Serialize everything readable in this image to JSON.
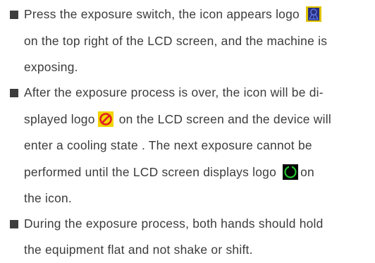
{
  "paragraphs": [
    {
      "lines": [
        {
          "segments": [
            {
              "text": "Press the exposure switch, the icon appears  logo "
            }
          ]
        },
        {
          "segments": [
            {
              "text": "on the top right of the LCD screen, and the machine is"
            }
          ]
        },
        {
          "segments": [
            {
              "text": "exposing."
            }
          ]
        }
      ]
    },
    {
      "lines": [
        {
          "segments": [
            {
              "text": "After the exposure process is over, the icon will be di-"
            }
          ]
        },
        {
          "segments": [
            {
              "text": "splayed logo"
            },
            {
              "text": "  on the LCD screen and the device will"
            }
          ]
        },
        {
          "segments": [
            {
              "text": " enter a cooling state . The  next  exposure  cannot be"
            }
          ]
        },
        {
          "segments": [
            {
              "text": "performed  until  the  LCD screen displays logo "
            },
            {
              "text": "on"
            }
          ]
        },
        {
          "segments": [
            {
              "text": "the icon."
            }
          ]
        }
      ]
    },
    {
      "lines": [
        {
          "segments": [
            {
              "text": "During the exposure process, both hands should hold"
            }
          ]
        },
        {
          "segments": [
            {
              "text": "the equipment flat and not shake or shift."
            }
          ]
        }
      ]
    }
  ],
  "icons": {
    "exposing": {
      "name": "radiation-exposure-icon",
      "color": "#4a5ad0",
      "background": "#e0c300"
    },
    "prohibited": {
      "name": "prohibited-cooling-icon",
      "color": "#e02020",
      "background": "#f2d500"
    },
    "ready": {
      "name": "ready-ring-icon",
      "color": "#22c32f",
      "background": "#000000"
    }
  },
  "colors": {
    "text": "#3b3b3b",
    "bullet": "#3d3d3d"
  }
}
